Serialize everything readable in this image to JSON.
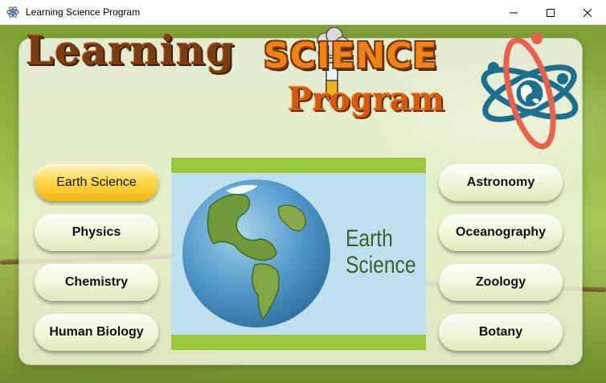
{
  "window": {
    "title": "Learning Science Program",
    "icon": "atom-icon",
    "controls": [
      "minimize-icon",
      "maximize-icon",
      "close-icon"
    ]
  },
  "header": {
    "word1": "Learning",
    "word2": "SCIENCE",
    "word3": "Program"
  },
  "subjects_left": [
    {
      "label": "Earth Science",
      "selected": true
    },
    {
      "label": "Physics",
      "selected": false
    },
    {
      "label": "Chemistry",
      "selected": false
    },
    {
      "label": "Human Biology",
      "selected": false
    }
  ],
  "subjects_right": [
    {
      "label": "Astronomy",
      "selected": false
    },
    {
      "label": "Oceanography",
      "selected": false
    },
    {
      "label": "Zoology",
      "selected": false
    },
    {
      "label": "Botany",
      "selected": false
    }
  ],
  "preview": {
    "line1": "Earth",
    "line2": "Science"
  },
  "colors": {
    "selected_button": "#ffd84a",
    "logo_brown": "#7a3d12",
    "logo_orange": "#f08218",
    "preview_band": "#9ac83a",
    "preview_bg": "#bfe0ee"
  }
}
